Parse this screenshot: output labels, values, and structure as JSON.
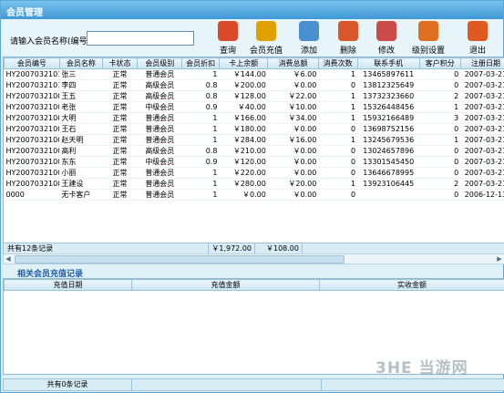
{
  "window": {
    "title": "会员管理"
  },
  "search": {
    "label": "请输入会员名称(编号)",
    "value": ""
  },
  "toolbar": [
    {
      "id": "query",
      "label": "查询",
      "icon": "search-icon",
      "color": "#d94a2a"
    },
    {
      "id": "recharge",
      "label": "会员充值",
      "icon": "dollar-icon",
      "color": "#e0a000"
    },
    {
      "id": "add",
      "label": "添加",
      "icon": "add-document-icon",
      "color": "#4a8fd0"
    },
    {
      "id": "delete",
      "label": "删除",
      "icon": "delete-document-icon",
      "color": "#d9552a"
    },
    {
      "id": "edit",
      "label": "修改",
      "icon": "edit-document-icon",
      "color": "#cc4a4a"
    },
    {
      "id": "level",
      "label": "级别设置",
      "icon": "gear-icon",
      "color": "#e07020"
    },
    {
      "id": "exit",
      "label": "退出",
      "icon": "power-icon",
      "color": "#e05a20"
    }
  ],
  "members": {
    "columns": [
      "会员编号",
      "会员名称",
      "卡状态",
      "会员级别",
      "会员折扣",
      "卡上余额",
      "消费总额",
      "消费次数",
      "联系手机",
      "客户积分",
      "注册日期",
      "最后一"
    ],
    "rows": [
      [
        "HY20070321011",
        "张三",
        "正常",
        "普通会员",
        "1",
        "￥144.00",
        "￥6.00",
        "1",
        "13465897611",
        "0",
        "2007-03-21",
        "2007-03-"
      ],
      [
        "HY20070321010",
        "李四",
        "正常",
        "高级会员",
        "0.8",
        "￥200.00",
        "￥0.00",
        "0",
        "13812325649",
        "0",
        "2007-03-21",
        "2007-03-"
      ],
      [
        "HY20070321009",
        "王五",
        "正常",
        "高级会员",
        "0.8",
        "￥128.00",
        "￥22.00",
        "1",
        "13732323660",
        "2",
        "2007-03-21",
        "2007-03-"
      ],
      [
        "HY20070321008",
        "老张",
        "正常",
        "中级会员",
        "0.9",
        "￥40.00",
        "￥10.00",
        "1",
        "15326448456",
        "1",
        "2007-03-21",
        "2007-03-"
      ],
      [
        "HY20070321007",
        "大明",
        "正常",
        "普通会员",
        "1",
        "￥166.00",
        "￥34.00",
        "1",
        "15932166489",
        "3",
        "2007-03-21",
        "2007-03-"
      ],
      [
        "HY20070321006",
        "王石",
        "正常",
        "普通会员",
        "1",
        "￥180.00",
        "￥0.00",
        "0",
        "13698752156",
        "0",
        "2007-03-21",
        "2007-03-"
      ],
      [
        "HY20070321005",
        "赵天明",
        "正常",
        "普通会员",
        "1",
        "￥284.00",
        "￥16.00",
        "1",
        "13245679536",
        "1",
        "2007-03-21",
        "2007-03-"
      ],
      [
        "HY20070321004",
        "高利",
        "正常",
        "高级会员",
        "0.8",
        "￥210.00",
        "￥0.00",
        "0",
        "13024657896",
        "0",
        "2007-03-21",
        "2007-03-"
      ],
      [
        "HY20070321003",
        "东东",
        "正常",
        "中级会员",
        "0.9",
        "￥120.00",
        "￥0.00",
        "0",
        "13301545450",
        "0",
        "2007-03-21",
        "2007-03-"
      ],
      [
        "HY20070321002",
        "小丽",
        "正常",
        "普通会员",
        "1",
        "￥220.00",
        "￥0.00",
        "0",
        "13646678995",
        "0",
        "2007-03-21",
        "2007-03-"
      ],
      [
        "HY20070321001",
        "王建设",
        "正常",
        "普通会员",
        "1",
        "￥280.00",
        "￥20.00",
        "1",
        "13923106445",
        "2",
        "2007-03-21",
        "2007-03-"
      ],
      [
        "0000",
        "无卡客户",
        "正常",
        "普通会员",
        "1",
        "￥0.00",
        "￥0.00",
        "0",
        "",
        "0",
        "2006-12-13",
        "2006-12-"
      ]
    ]
  },
  "summary": {
    "count": "共有12条记录",
    "balance_total": "￥1,972.00",
    "spend_total": "￥108.00"
  },
  "recharge": {
    "title": "相关会员充值记录",
    "columns": [
      "充值日期",
      "充值金额",
      "实收金额"
    ],
    "footer": "共有0条记录"
  },
  "watermark": "3HE 当游网"
}
